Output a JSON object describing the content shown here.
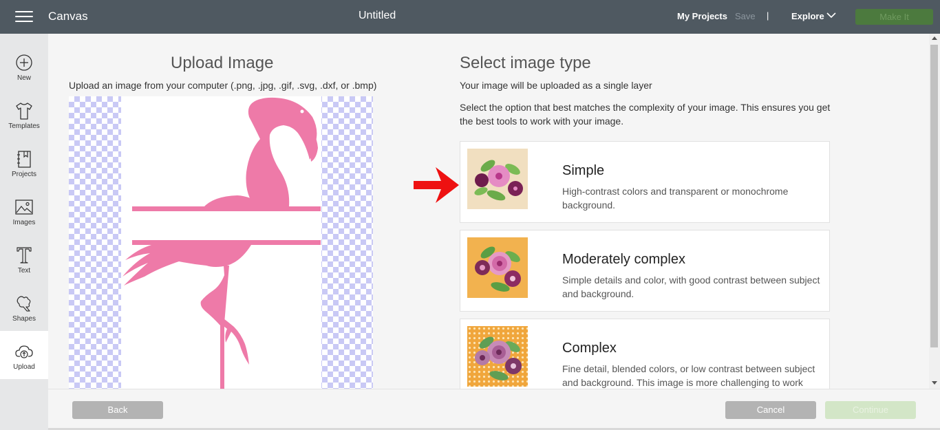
{
  "header": {
    "app_name": "Canvas",
    "doc_title": "Untitled",
    "my_projects": "My Projects",
    "save": "Save",
    "separator": "|",
    "explore": "Explore",
    "make_it": "Make It"
  },
  "sidebar": {
    "items": [
      {
        "label": "New",
        "icon": "plus-circle-icon"
      },
      {
        "label": "Templates",
        "icon": "tshirt-icon"
      },
      {
        "label": "Projects",
        "icon": "notebook-icon"
      },
      {
        "label": "Images",
        "icon": "image-icon"
      },
      {
        "label": "Text",
        "icon": "text-t-icon"
      },
      {
        "label": "Shapes",
        "icon": "shapes-icon"
      },
      {
        "label": "Upload",
        "icon": "cloud-upload-icon"
      }
    ],
    "active": "Upload"
  },
  "upload": {
    "title": "Upload Image",
    "subtitle": "Upload an image from your computer (.png, .jpg, .gif, .svg, .dxf, or .bmp)"
  },
  "select": {
    "title": "Select image type",
    "line1": "Your image will be uploaded as a single layer",
    "line2": "Select the option that best matches the complexity of your image. This ensures you get the best tools to work with your image."
  },
  "cards": [
    {
      "title": "Simple",
      "desc": "High-contrast colors and transparent or monochrome background."
    },
    {
      "title": "Moderately complex",
      "desc": "Simple details and color, with good contrast between subject and background."
    },
    {
      "title": "Complex",
      "desc": "Fine detail, blended colors, or low contrast between subject and background. This image is more challenging to work"
    }
  ],
  "footer": {
    "back": "Back",
    "cancel": "Cancel",
    "continue": "Continue"
  },
  "colors": {
    "topbar": "#4f5961",
    "make_it": "#4c7a3e",
    "flamingo": "#ee7aa8",
    "checker": "#c9c9f5",
    "arrow": "#ee1111"
  }
}
